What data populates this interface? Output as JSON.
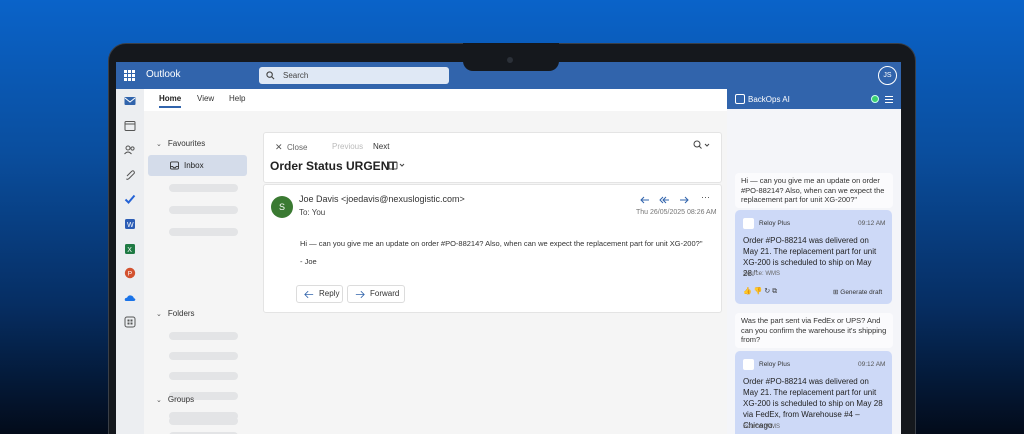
{
  "topbar": {
    "app_title": "Outlook",
    "search_placeholder": "Search",
    "user_initials": "JS"
  },
  "ribbon": {
    "tabs": [
      "Home",
      "View",
      "Help"
    ]
  },
  "folders": {
    "favourites": "Favourites",
    "inbox": "Inbox",
    "folders": "Folders",
    "groups": "Groups"
  },
  "toolbar": {
    "close": "Close",
    "previous": "Previous",
    "next": "Next"
  },
  "email": {
    "subject": "Order Status URGENT",
    "avatar_letter": "S",
    "sender": "Joe Davis <joedavis@nexuslogistic.com>",
    "to": "To:  You",
    "date": "Thu 26/05/2025 08:26 AM",
    "body": "Hi — can you give me an update on order #PO-88214? Also, when can we expect the replacement part for unit XG-200?\"",
    "signature": "- Joe",
    "reply": "Reply",
    "forward": "Forward"
  },
  "assistant": {
    "title": "BackOps AI",
    "user_message_1": "Hi — can you give me an update on order #PO-88214? Also, when can we expect the replacement part for unit XG-200?\"",
    "reply_1": {
      "name": "Reloy Plus",
      "time": "09:12 AM",
      "text": "Order #PO-88214 was delivered on May 21. The replacement part for unit XG-200 is scheduled to ship on May 28.\"",
      "source": "Source: WMS",
      "generate": "Generate draft"
    },
    "user_message_2": "Was the part sent via FedEx or UPS? And can you confirm the warehouse it's shipping from?",
    "reply_2": {
      "name": "Reloy Plus",
      "time": "09:12 AM",
      "text": "Order #PO-88214 was delivered on May 21. The replacement part for unit XG-200 is scheduled to ship on May 28 via FedEx, from Warehouse #4 – Chicago.",
      "source": "Source: WMS"
    }
  },
  "colors": {
    "brand": "#3164ac",
    "avatar": "#3a7a32",
    "ai_bubble": "#cdd9f7",
    "status_dot": "#3bd16f"
  }
}
